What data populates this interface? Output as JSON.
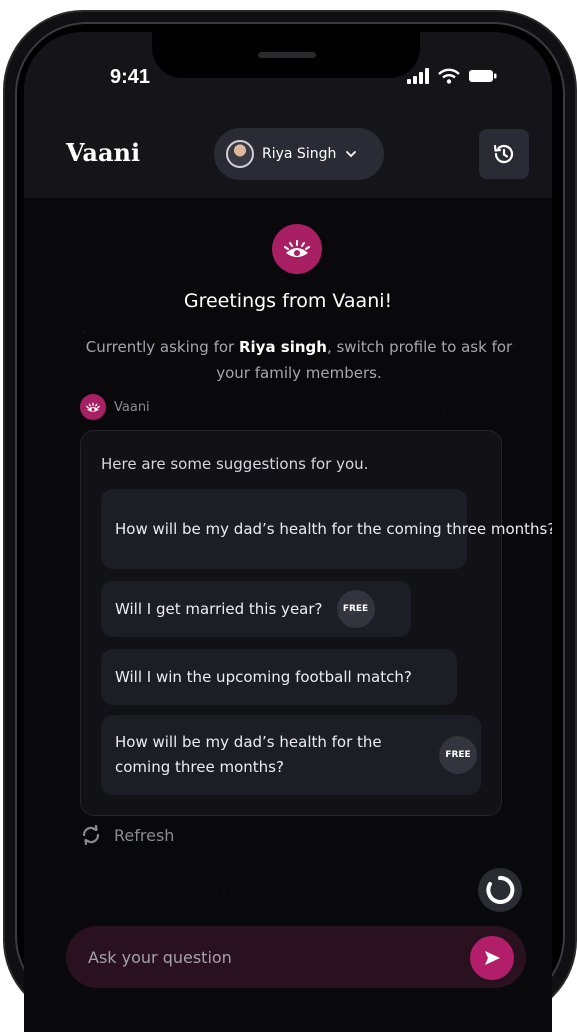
{
  "status": {
    "time": "9:41"
  },
  "header": {
    "app_title": "Vaani",
    "profile_name": "Riya Singh"
  },
  "welcome": {
    "greeting": "Greetings from Vaani!",
    "subtitle_prefix": "Currently asking for ",
    "subtitle_name": "Riya singh",
    "subtitle_suffix": ", switch profile to ask for your family members."
  },
  "bot": {
    "name": "Vaani"
  },
  "suggestions": {
    "heading": "Here are some suggestions for you.",
    "items": [
      {
        "text": "How will be my dad’s health for the coming three months?",
        "badge": ""
      },
      {
        "text": "Will I get married this year?",
        "badge": "FREE"
      },
      {
        "text": "Will I win the upcoming football match?",
        "badge": ""
      },
      {
        "text": "How will be my dad’s health for the coming three months?",
        "badge": "FREE"
      }
    ]
  },
  "refresh": {
    "label": "Refresh"
  },
  "composer": {
    "placeholder": "Ask your question"
  },
  "colors": {
    "accent": "#a81f63",
    "background": "#09090b"
  }
}
